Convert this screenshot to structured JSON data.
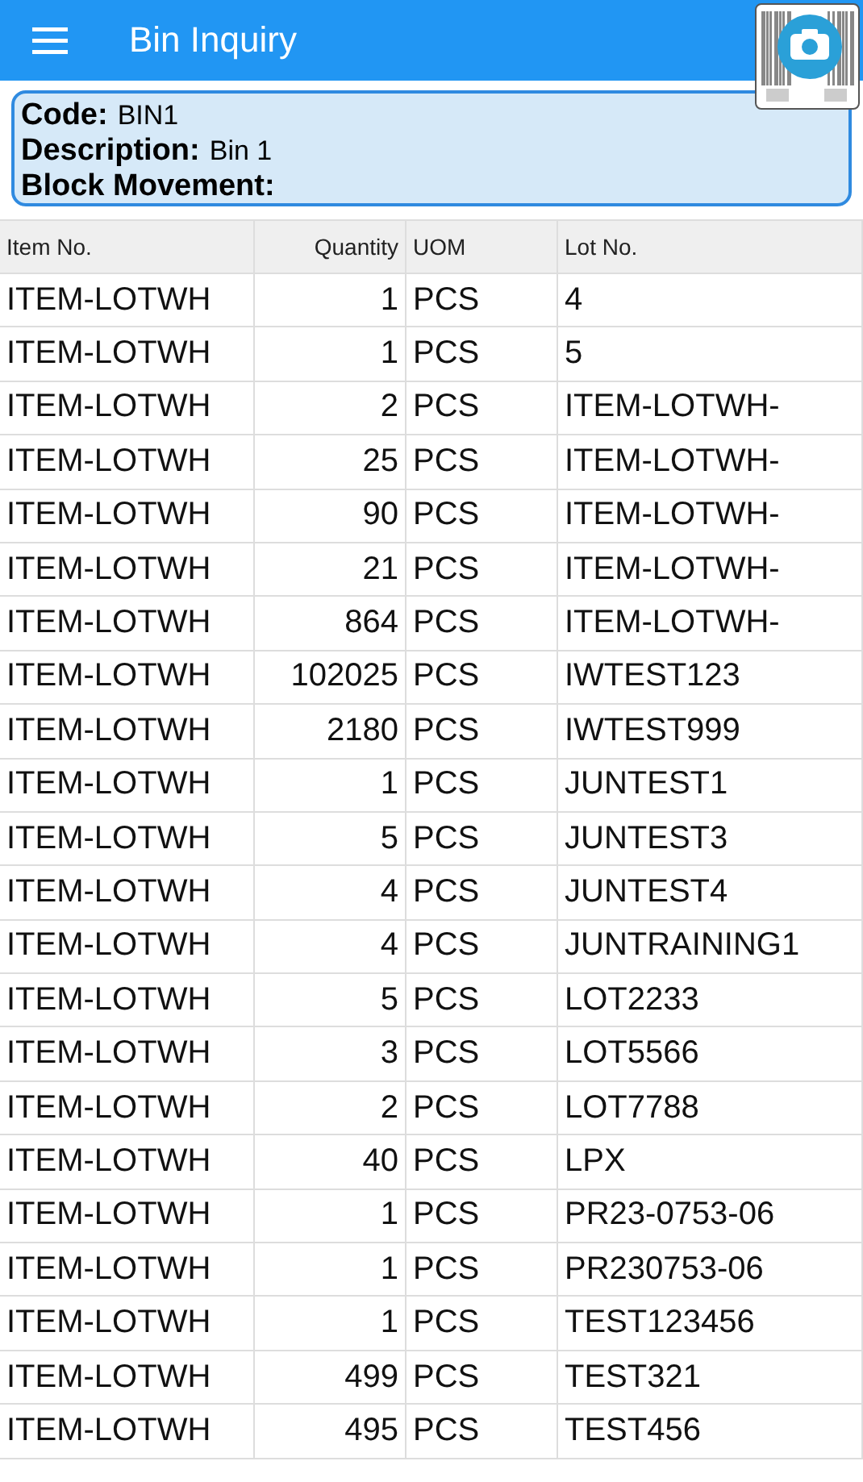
{
  "app_bar": {
    "title": "Bin Inquiry"
  },
  "bin": {
    "fields": [
      {
        "label": "Code:",
        "value": "BIN1"
      },
      {
        "label": "Description:",
        "value": "Bin 1"
      },
      {
        "label": "Block Movement:"
      }
    ]
  },
  "table": {
    "columns": [
      "Item No.",
      "Quantity",
      "UOM",
      "Lot No."
    ],
    "rows": [
      [
        "ITEM-LOTWH",
        "1",
        "PCS",
        "4"
      ],
      [
        "ITEM-LOTWH",
        "1",
        "PCS",
        "5"
      ],
      [
        "ITEM-LOTWH",
        "2",
        "PCS",
        "ITEM-LOTWH-"
      ],
      [
        "ITEM-LOTWH",
        "25",
        "PCS",
        "ITEM-LOTWH-"
      ],
      [
        "ITEM-LOTWH",
        "90",
        "PCS",
        "ITEM-LOTWH-"
      ],
      [
        "ITEM-LOTWH",
        "21",
        "PCS",
        "ITEM-LOTWH-"
      ],
      [
        "ITEM-LOTWH",
        "864",
        "PCS",
        "ITEM-LOTWH-"
      ],
      [
        "ITEM-LOTWH",
        "102025",
        "PCS",
        "IWTEST123"
      ],
      [
        "ITEM-LOTWH",
        "2180",
        "PCS",
        "IWTEST999"
      ],
      [
        "ITEM-LOTWH",
        "1",
        "PCS",
        "JUNTEST1"
      ],
      [
        "ITEM-LOTWH",
        "5",
        "PCS",
        "JUNTEST3"
      ],
      [
        "ITEM-LOTWH",
        "4",
        "PCS",
        "JUNTEST4"
      ],
      [
        "ITEM-LOTWH",
        "4",
        "PCS",
        "JUNTRAINING1"
      ],
      [
        "ITEM-LOTWH",
        "5",
        "PCS",
        "LOT2233"
      ],
      [
        "ITEM-LOTWH",
        "3",
        "PCS",
        "LOT5566"
      ],
      [
        "ITEM-LOTWH",
        "2",
        "PCS",
        "LOT7788"
      ],
      [
        "ITEM-LOTWH",
        "40",
        "PCS",
        "LPX"
      ],
      [
        "ITEM-LOTWH",
        "1",
        "PCS",
        "PR23-0753-06"
      ],
      [
        "ITEM-LOTWH",
        "1",
        "PCS",
        "PR230753-06"
      ],
      [
        "ITEM-LOTWH",
        "1",
        "PCS",
        "TEST123456"
      ],
      [
        "ITEM-LOTWH",
        "499",
        "PCS",
        "TEST321"
      ],
      [
        "ITEM-LOTWH",
        "495",
        "PCS",
        "TEST456"
      ]
    ]
  }
}
